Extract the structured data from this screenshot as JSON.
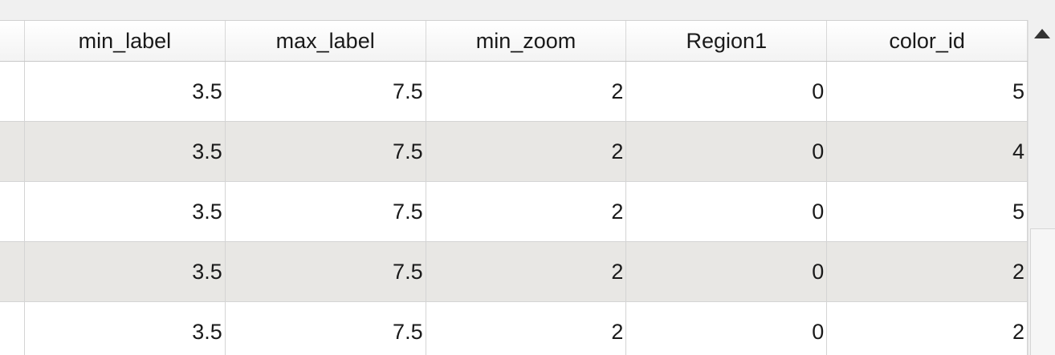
{
  "table": {
    "columns": [
      "min_label",
      "max_label",
      "min_zoom",
      "Region1",
      "color_id"
    ],
    "rows": [
      [
        "3.5",
        "7.5",
        "2",
        "0",
        "5"
      ],
      [
        "3.5",
        "7.5",
        "2",
        "0",
        "4"
      ],
      [
        "3.5",
        "7.5",
        "2",
        "0",
        "5"
      ],
      [
        "3.5",
        "7.5",
        "2",
        "0",
        "2"
      ],
      [
        "3.5",
        "7.5",
        "2",
        "0",
        "2"
      ]
    ]
  },
  "scrollbar": {
    "up_icon": "triangle-up-icon"
  }
}
